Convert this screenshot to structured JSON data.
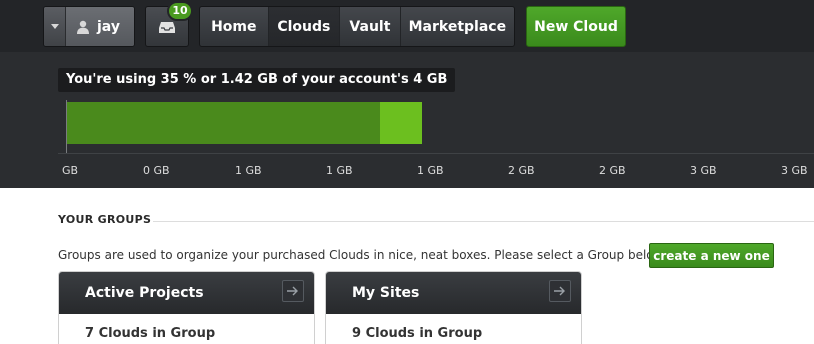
{
  "user": {
    "name": "jay"
  },
  "inbox": {
    "badge_count": "10"
  },
  "nav": {
    "items": [
      {
        "label": "Home"
      },
      {
        "label": "Clouds"
      },
      {
        "label": "Vault"
      },
      {
        "label": "Marketplace"
      }
    ],
    "active": "Clouds"
  },
  "new_cloud_label": "New Cloud",
  "usage": {
    "summary": "You're using 35 % or 1.42 GB of your account's 4 GB",
    "used_fraction": 0.35,
    "tick_labels": [
      "GB",
      "0 GB",
      "1 GB",
      "1 GB",
      "1 GB",
      "2 GB",
      "2 GB",
      "3 GB",
      "3 GB"
    ]
  },
  "groups": {
    "title": "YOUR GROUPS",
    "description": "Groups are used to organize your purchased Clouds in nice, neat boxes. Please select a Group below or",
    "create_label": "create a new one",
    "cards": [
      {
        "title": "Active Projects",
        "count_text": "7 Clouds in Group"
      },
      {
        "title": "My Sites",
        "count_text": "9 Clouds in Group"
      }
    ]
  },
  "colors": {
    "accent_green": "#4a9a1f",
    "bar_used": "#4a8a1c",
    "bar_highlight": "#6cbf1f",
    "topbar_bg": "#232528"
  }
}
